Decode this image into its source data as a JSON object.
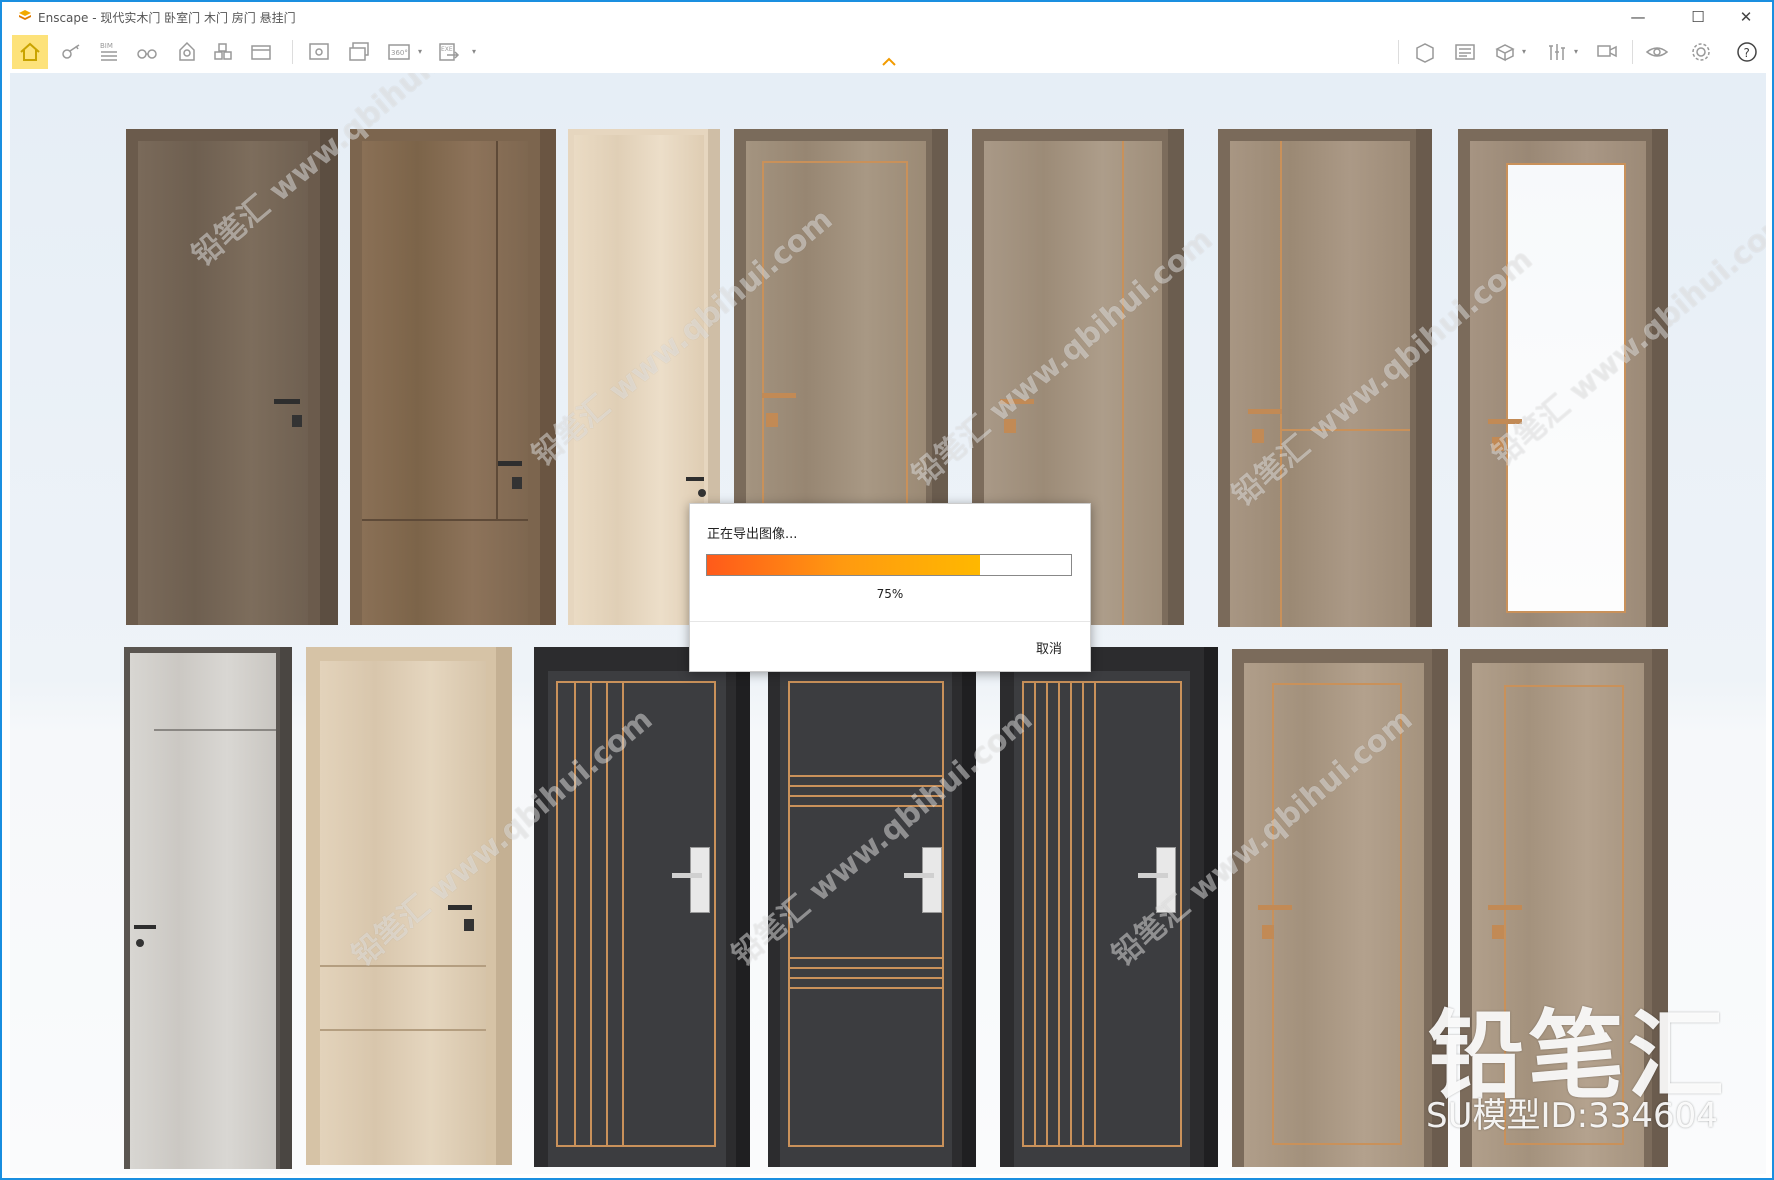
{
  "window": {
    "title": "Enscape - 现代实木门 卧室门 木门 房门 悬挂门",
    "controls": {
      "minimize": "—",
      "maximize": "☐",
      "close": "✕"
    }
  },
  "toolbar": {
    "left_tools": [
      "home-icon",
      "walk-icon",
      "bim-icon",
      "binoculars-icon",
      "light-icon",
      "cube-stack-icon",
      "view-management-icon",
      "screenshot-icon",
      "batch-render-icon",
      "panorama-icon",
      "export-icon"
    ],
    "right_tools": [
      "asset-library-icon",
      "material-editor-icon",
      "atmosphere-icon",
      "visual-settings-icon",
      "upload-icon",
      "vr-icon",
      "settings-icon",
      "help-icon"
    ],
    "bim_label": "BIM",
    "pano_label": "360°",
    "exe_label": "EXE"
  },
  "watermark": {
    "brand": "铅笔汇",
    "model_id": "SU模型ID:334604",
    "small": "铅笔汇 www.qbihui.com"
  },
  "dialog": {
    "message": "正在导出图像...",
    "progress": 0.75,
    "percent_label": "75%",
    "cancel_label": "取消"
  },
  "colors": {
    "accent": "#1e9be9",
    "home_highlight": "#fde27a",
    "progress_start": "#ff5a1a",
    "progress_end": "#ffb800",
    "copper_trim": "#c9915a"
  }
}
